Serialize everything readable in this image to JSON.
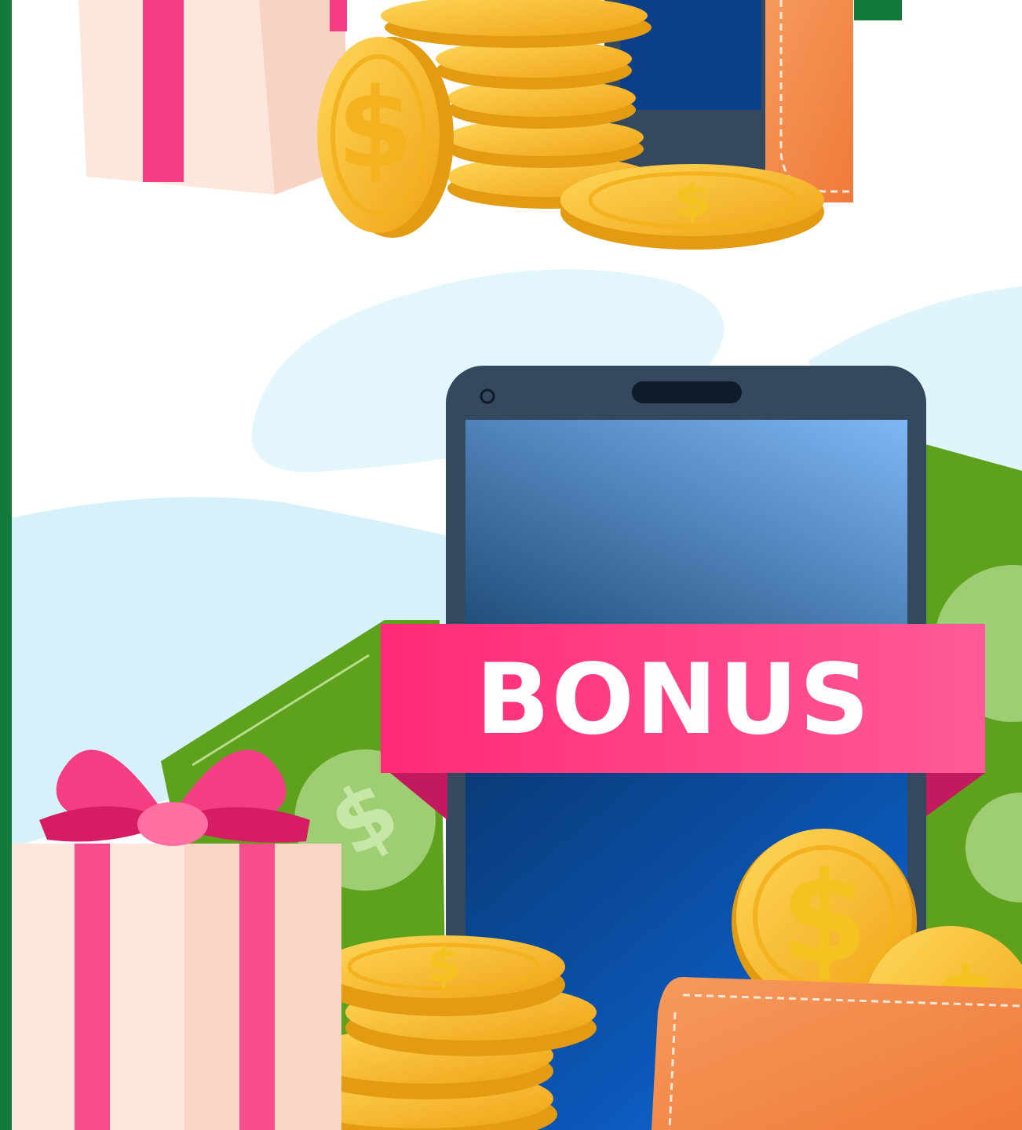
{
  "banner": {
    "label": "BONUS"
  },
  "colors": {
    "brand_green": "#127a3a",
    "banner_pink": "#ff2f7a",
    "coin_gold": "#f6b51b",
    "phone_frame": "#34495e",
    "wallet_orange": "#f28a4a",
    "money_green": "#5ea11c",
    "sky": "#dff4fb"
  },
  "icons": {
    "gift": "gift-box-icon",
    "coin": "dollar-coin-icon",
    "phone": "smartphone-icon",
    "wallet": "wallet-icon",
    "banknote": "banknote-icon"
  }
}
